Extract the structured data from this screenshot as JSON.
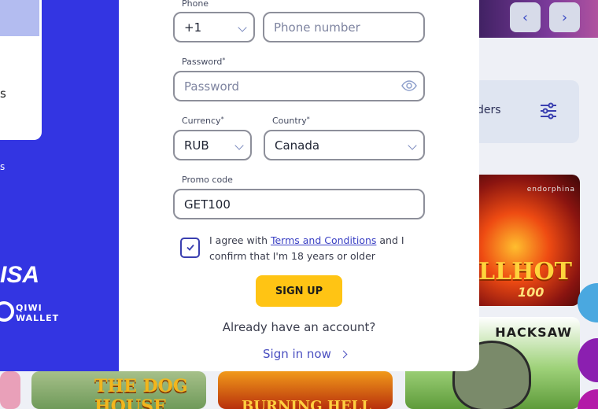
{
  "form": {
    "phone": {
      "label": "Phone",
      "code": "+1",
      "placeholder": "Phone number"
    },
    "password": {
      "label": "Password",
      "required_mark": "*",
      "placeholder": "Password"
    },
    "currency": {
      "label": "Currency",
      "required_mark": "*",
      "value": "RUB"
    },
    "country": {
      "label": "Country",
      "required_mark": "*",
      "value": "Canada"
    },
    "promo": {
      "label": "Promo code",
      "value": "GET100"
    },
    "agree": {
      "prefix": "I agree with ",
      "link": "Terms and Conditions",
      "suffix": " and I confirm that I'm 18 years or older",
      "checked": true
    },
    "signup_label": "SIGN UP",
    "have_account": "Already have an account?",
    "signin_label": "Sign in now"
  },
  "background": {
    "filter_label": "ders",
    "sidebar_fragments": [
      "s",
      "s"
    ],
    "payment": {
      "visa": "ISA",
      "qiwi": "QIWI WALLET"
    },
    "games": {
      "hot_provider": "endorphina",
      "hot_title": "LLHOT",
      "hot_number": "100",
      "hacksaw": "HACKSAW",
      "dog": "THE DOG HOUSE",
      "burning": "BURNING HELL"
    }
  },
  "colors": {
    "blue_panel": "#3335e2",
    "signup": "#ffc414",
    "link": "#3a40c4"
  }
}
